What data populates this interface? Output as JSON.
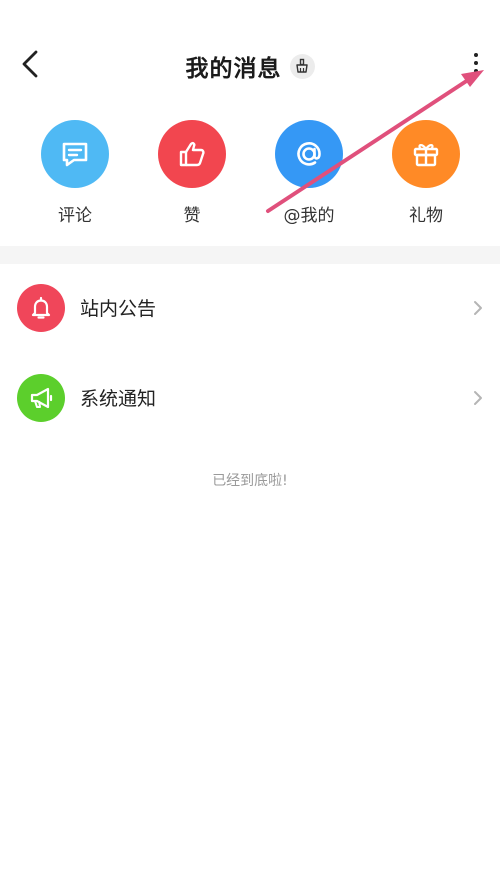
{
  "header": {
    "title": "我的消息",
    "back_icon": "back-chevron-icon",
    "clean_icon": "broom-icon",
    "more_icon": "more-vertical-icon"
  },
  "quick_actions": [
    {
      "label": "评论",
      "icon": "comment-icon",
      "color": "#4fb9f4"
    },
    {
      "label": "赞",
      "icon": "thumbs-up-icon",
      "color": "#f2464f"
    },
    {
      "label": "@我的",
      "icon": "at-sign-icon",
      "color": "#3598f5"
    },
    {
      "label": "礼物",
      "icon": "gift-icon",
      "color": "#ff8a26"
    }
  ],
  "list": [
    {
      "label": "站内公告",
      "icon": "bell-icon",
      "color": "#f0465a"
    },
    {
      "label": "系统通知",
      "icon": "megaphone-icon",
      "color": "#5ccf2c"
    }
  ],
  "end_hint": "已经到底啦!",
  "annotation": {
    "color": "#e0507c"
  }
}
